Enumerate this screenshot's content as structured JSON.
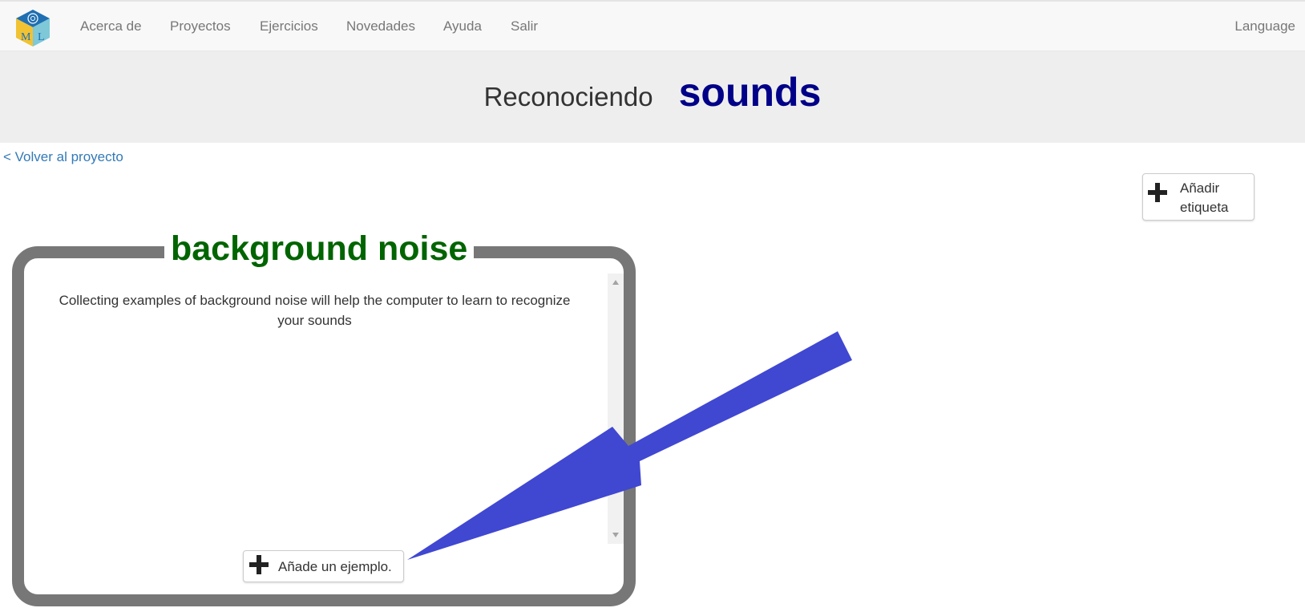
{
  "navbar": {
    "items": [
      {
        "label": "Acerca de"
      },
      {
        "label": "Proyectos"
      },
      {
        "label": "Ejercicios"
      },
      {
        "label": "Novedades"
      },
      {
        "label": "Ayuda"
      },
      {
        "label": "Salir"
      }
    ],
    "language_label": "Language",
    "logo_letters": [
      "M",
      "L"
    ]
  },
  "header": {
    "prefix": "Reconociendo",
    "project_name": "sounds"
  },
  "back_link": "< Volver al proyecto",
  "add_label_button": {
    "label": "Añadir etiqueta",
    "icon": "plus-icon"
  },
  "label_card": {
    "title": "background noise",
    "description": "Collecting examples of background noise will help the computer to learn to recognize your sounds",
    "add_example_label": "Añade un ejemplo.",
    "add_example_icon": "plus-icon"
  },
  "colors": {
    "project_name": "#000088",
    "label_title": "#006400",
    "card_border": "#777777",
    "link": "#337ab7",
    "arrow": "#4047d1"
  }
}
